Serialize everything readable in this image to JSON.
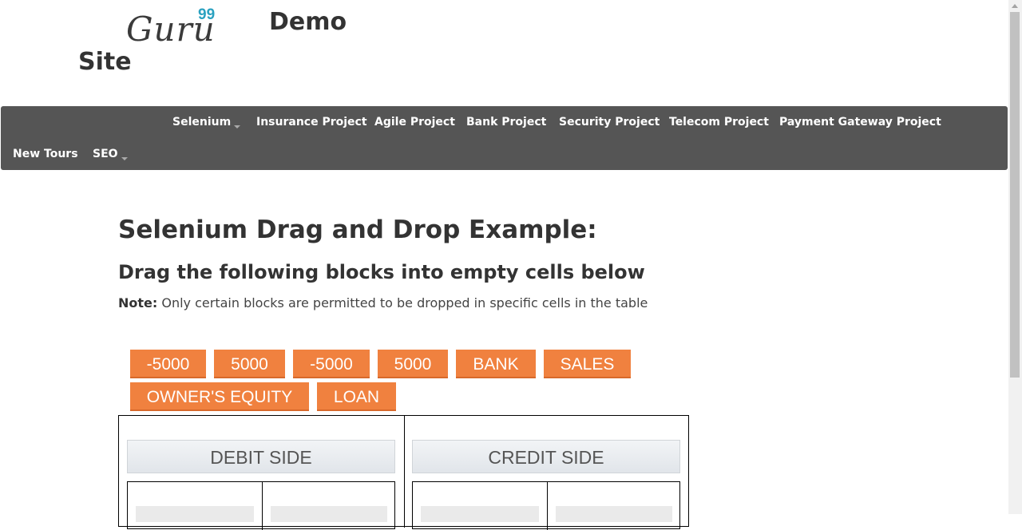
{
  "header": {
    "logo_text": "Guru",
    "logo_sup": "99",
    "title_line1": "Demo",
    "title_line2": "Site"
  },
  "nav": {
    "items": [
      {
        "label": "Selenium",
        "dropdown": true
      },
      {
        "label": "Insurance Project"
      },
      {
        "label": "Agile Project"
      },
      {
        "label": "Bank Project"
      },
      {
        "label": "Security Project"
      },
      {
        "label": "Telecom Project"
      },
      {
        "label": "Payment Gateway Project"
      },
      {
        "label": "New Tours"
      },
      {
        "label": "SEO",
        "dropdown": true
      }
    ]
  },
  "main": {
    "heading": "Selenium Drag and Drop Example:",
    "subheading": "Drag the following blocks into empty cells below",
    "note_label": "Note:",
    "note_text": " Only certain blocks are permitted to be dropped in specific cells in the table"
  },
  "blocks": [
    "-5000",
    "5000",
    "-5000",
    "5000",
    "BANK",
    "SALES",
    "OWNER'S EQUITY",
    "LOAN"
  ],
  "table": {
    "debit_header": "DEBIT SIDE",
    "credit_header": "CREDIT SIDE"
  },
  "colors": {
    "navbar": "#555555",
    "block": "#f0813f",
    "logo_accent": "#2aa1c0"
  }
}
